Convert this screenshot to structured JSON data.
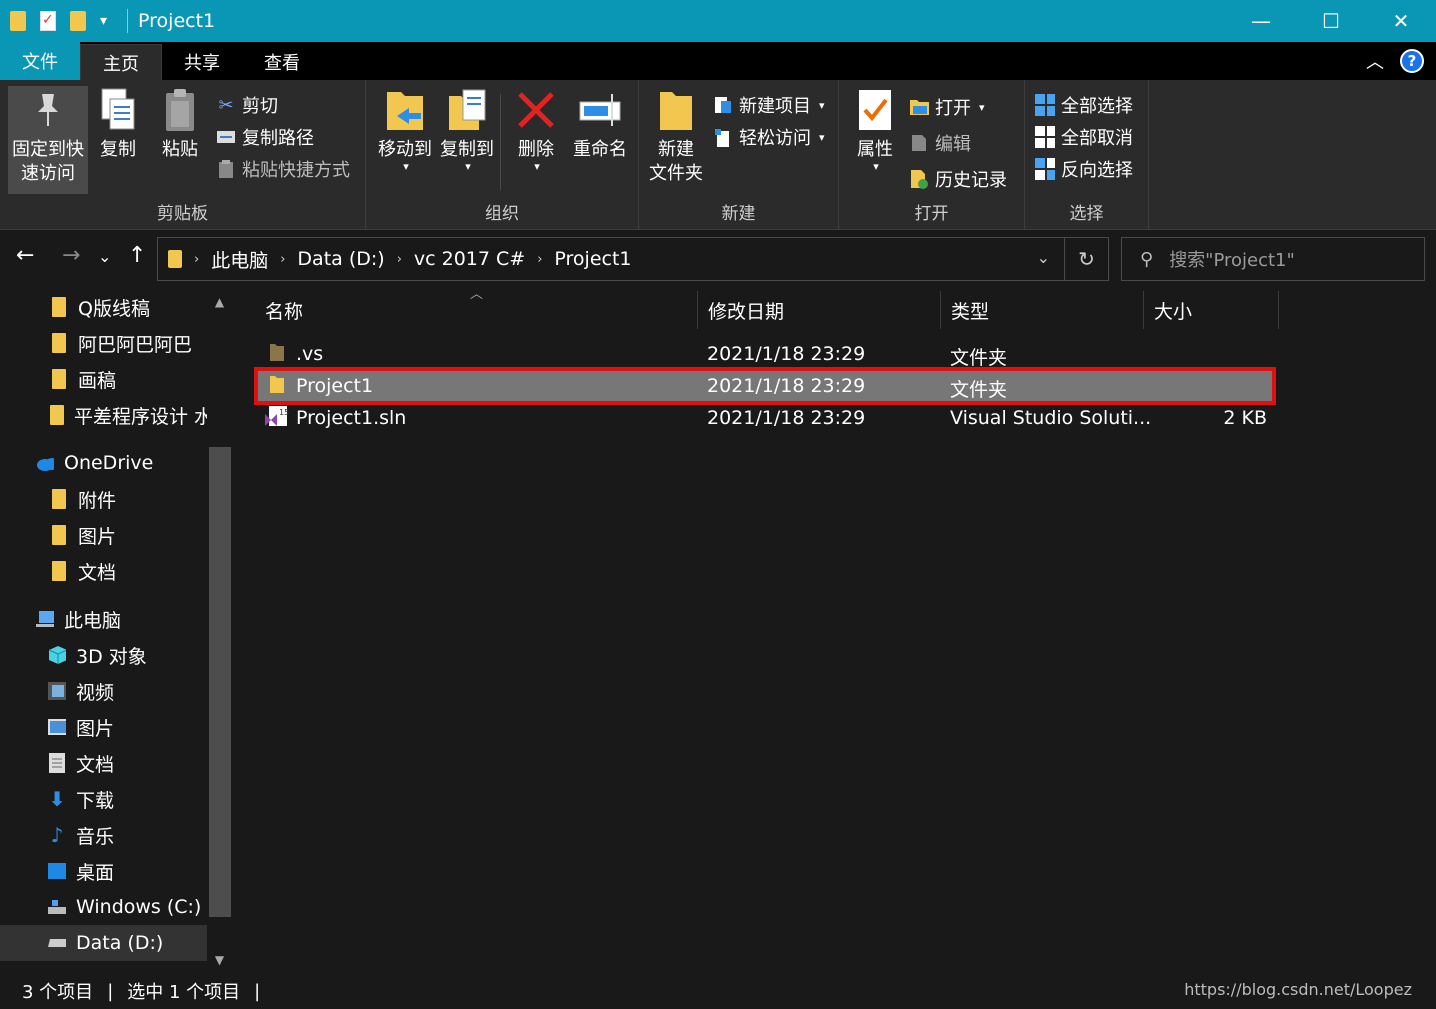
{
  "window": {
    "title": "Project1",
    "minimize": "—",
    "maximize": "☐",
    "close": "✕"
  },
  "menu": {
    "file": "文件",
    "home": "主页",
    "share": "共享",
    "view": "查看"
  },
  "ribbon": {
    "clipboard": {
      "label": "剪贴板",
      "pin": [
        "固定到快",
        "速访问"
      ],
      "copy": "复制",
      "paste": "粘贴",
      "cut": "剪切",
      "copy_path": "复制路径",
      "paste_shortcut": "粘贴快捷方式"
    },
    "organize": {
      "label": "组织",
      "move_to": "移动到",
      "copy_to": "复制到",
      "delete": "删除",
      "rename": "重命名"
    },
    "new": {
      "label": "新建",
      "new_folder": [
        "新建",
        "文件夹"
      ],
      "new_item": "新建项目",
      "easy_access": "轻松访问"
    },
    "open": {
      "label": "打开",
      "properties": "属性",
      "open": "打开",
      "edit": "编辑",
      "history": "历史记录"
    },
    "select": {
      "label": "选择",
      "select_all": "全部选择",
      "select_none": "全部取消",
      "invert": "反向选择"
    }
  },
  "address": {
    "crumbs": [
      "此电脑",
      "Data (D:)",
      "vc 2017 C#",
      "Project1"
    ],
    "search_placeholder": "搜索\"Project1\""
  },
  "sidebar": {
    "items": [
      {
        "label": "Q版线稿",
        "icon": "folder-icon"
      },
      {
        "label": "阿巴阿巴阿巴",
        "icon": "folder-icon"
      },
      {
        "label": "画稿",
        "icon": "folder-icon"
      },
      {
        "label": "平差程序设计 水",
        "icon": "folder-icon"
      },
      {
        "label": "OneDrive",
        "icon": "cloud-icon"
      },
      {
        "label": "附件",
        "icon": "folder-icon"
      },
      {
        "label": "图片",
        "icon": "folder-icon"
      },
      {
        "label": "文档",
        "icon": "folder-icon"
      },
      {
        "label": "此电脑",
        "icon": "computer-icon"
      },
      {
        "label": "3D 对象",
        "icon": "cube-icon"
      },
      {
        "label": "视频",
        "icon": "video-icon"
      },
      {
        "label": "图片",
        "icon": "picture-icon"
      },
      {
        "label": "文档",
        "icon": "document-icon"
      },
      {
        "label": "下载",
        "icon": "download-icon"
      },
      {
        "label": "音乐",
        "icon": "music-icon"
      },
      {
        "label": "桌面",
        "icon": "desktop-icon"
      },
      {
        "label": "Windows (C:)",
        "icon": "drive-icon"
      },
      {
        "label": "Data (D:)",
        "icon": "drive-icon"
      }
    ]
  },
  "columns": {
    "name": "名称",
    "modified": "修改日期",
    "type": "类型",
    "size": "大小"
  },
  "files": [
    {
      "name": ".vs",
      "modified": "2021/1/18 23:29",
      "type": "文件夹",
      "size": ""
    },
    {
      "name": "Project1",
      "modified": "2021/1/18 23:29",
      "type": "文件夹",
      "size": ""
    },
    {
      "name": "Project1.sln",
      "modified": "2021/1/18 23:29",
      "type": "Visual Studio Soluti...",
      "size": "2 KB"
    }
  ],
  "status": {
    "count": "3 个项目",
    "selected": "选中 1 个项目",
    "watermark": "https://blog.csdn.net/Loopez"
  },
  "colors": {
    "accent": "#0a97b5",
    "folder": "#f1c74f",
    "highlight": "#e01010"
  }
}
